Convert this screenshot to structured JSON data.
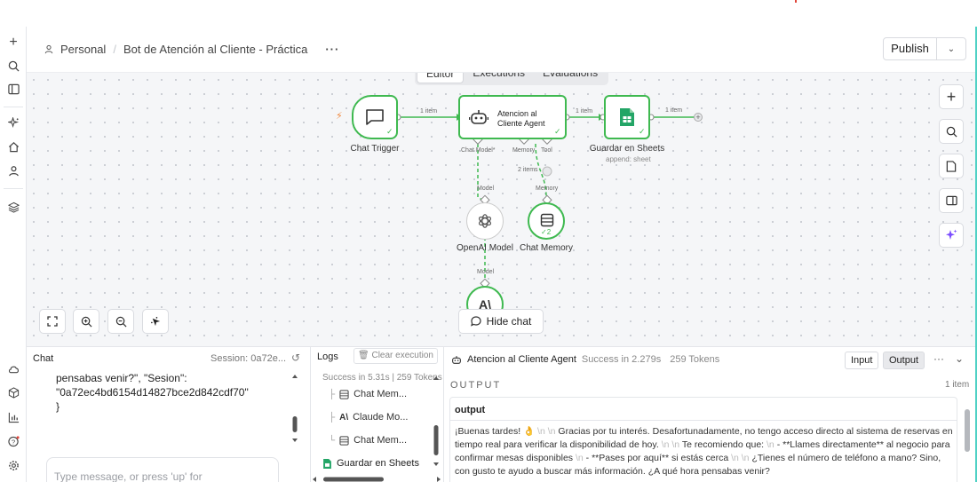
{
  "header": {
    "project": "Personal",
    "workflow_name": "Bot de Atención al Cliente - Práctica",
    "more": "···",
    "publish_label": "Publish"
  },
  "tabs": [
    {
      "label": "Editor",
      "active": true
    },
    {
      "label": "Executions",
      "active": false
    },
    {
      "label": "Evaluations",
      "active": false
    }
  ],
  "nodes": {
    "chat_trigger": "Chat Trigger",
    "agent_line1": "Atencion al",
    "agent_line2": "Cliente Agent",
    "sheets": "Guardar en Sheets",
    "sheets_sub": "append: sheet",
    "openai": "OpenAI Model",
    "memory": "Chat Memory",
    "memory_badge": "2"
  },
  "edges": {
    "trigger_to_agent": "1 item",
    "agent_to_sheets": "1 item",
    "sheets_out": "1 item",
    "memory_items": "2 items",
    "port_chat_model": "Chat Model*",
    "port_memory": "Memory",
    "port_tool": "Tool",
    "openai_model_port": "Model",
    "memory_port": "Memory",
    "openai_out_model": "Model"
  },
  "canvas_controls": {
    "hide_chat": "Hide chat"
  },
  "chat_panel": {
    "title": "Chat",
    "session": "Session: 0a72e...",
    "message": "pensabas venir?\", \"Sesion\":\n\"0a72ec4bd6154d14827bce2d842cdf70\"\n}",
    "input_placeholder": "Type message, or press 'up' for"
  },
  "logs_panel": {
    "title": "Logs",
    "clear_label": "Clear execution",
    "summary": "Success in 5.31s  |  259 Tokens",
    "rows": [
      {
        "label": "Chat Mem..."
      },
      {
        "label": "Claude Mo..."
      },
      {
        "label": "Chat Mem..."
      }
    ],
    "sheets_row": "Guardar en Sheets"
  },
  "output_panel": {
    "node_name": "Atencion al Cliente Agent",
    "status": "Success in 2.279s",
    "tokens": "259 Tokens",
    "input_tab": "Input",
    "output_tab": "Output",
    "section_label": "OUTPUT",
    "count": "1 item",
    "key": "output",
    "value_parts": [
      "¡Buenas tardes! 👌",
      "\\n \\n",
      "Gracias por tu interés. Desafortunadamente, no tengo acceso directo al sistema de reservas en tiempo real para verificar la disponibilidad de hoy.",
      "\\n \\n",
      "Te recomiendo que:",
      "\\n",
      "- **Llames directamente** al negocio para confirmar mesas disponibles",
      "\\n",
      "- **Pases por aquí** si estás cerca",
      "\\n \\n",
      "¿Tienes el número de teléfono a mano? Sino, con gusto te ayudo a buscar más información. ¿A qué hora pensabas venir?"
    ]
  }
}
